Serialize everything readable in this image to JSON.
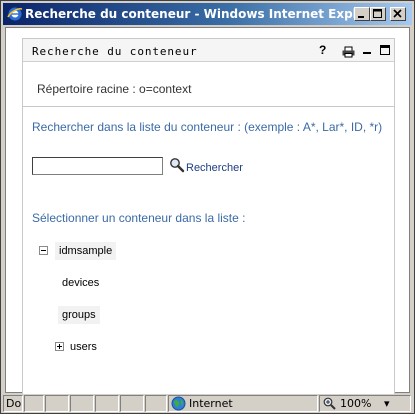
{
  "window": {
    "title": "Recherche du conteneur - Windows Internet Explorer"
  },
  "portlet": {
    "title": "Recherche du conteneur",
    "help_glyph": "?",
    "root_label": "Répertoire racine : o=context"
  },
  "search": {
    "title": "Rechercher dans la liste du conteneur : (exemple : A*, Lar*, ID, *r)",
    "input_value": "",
    "button_label": "Rechercher"
  },
  "select": {
    "title": "Sélectionner un conteneur dans la liste :"
  },
  "tree": {
    "root": "idmsample",
    "children": [
      "devices",
      "groups",
      "users"
    ]
  },
  "statusbar": {
    "status": "Do",
    "zone": "Internet",
    "zoom": "100%",
    "zoom_arrow": "▾"
  },
  "colors": {
    "link": "#1d3e82",
    "heading": "#3b6aa8",
    "titlebar_start": "#0a246a"
  }
}
